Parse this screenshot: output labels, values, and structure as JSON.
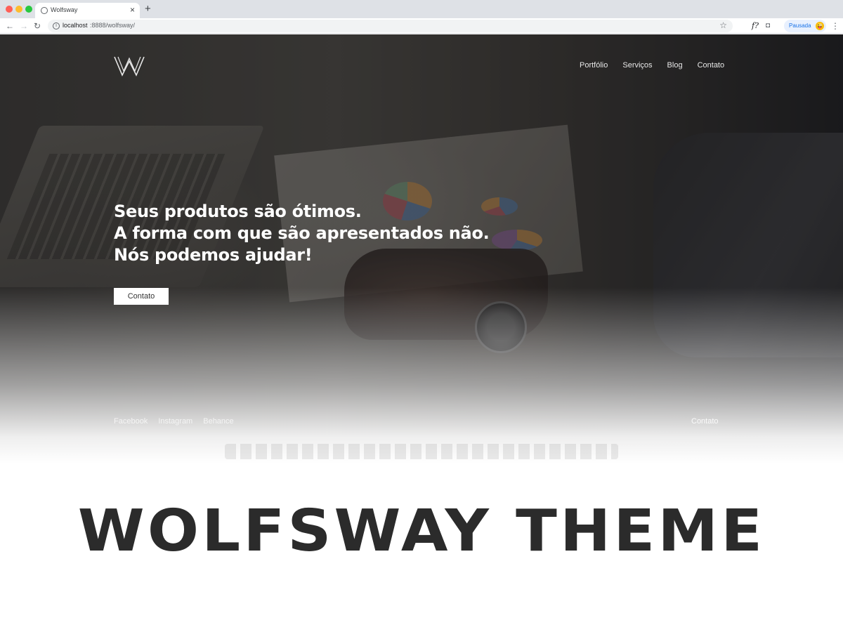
{
  "browser": {
    "tab_title": "Wolfsway",
    "tab_close": "×",
    "new_tab": "+",
    "url_host": "localhost",
    "url_path": ":8888/wolfsway/",
    "back": "←",
    "forward": "→",
    "reload": "↻",
    "info": "i",
    "star": "☆",
    "ext_f": "f?",
    "camera": "◘",
    "profile_label": "Pausada",
    "avatar": "😜",
    "menu": "⋮"
  },
  "site": {
    "nav": [
      "Portfólio",
      "Serviços",
      "Blog",
      "Contato"
    ],
    "headline": [
      "Seus produtos são ótimos.",
      "A forma com que são apresentados não.",
      "Nós podemos ajudar!"
    ],
    "cta_label": "Contato",
    "social": [
      "Facebook",
      "Instagram",
      "Behance"
    ],
    "footer_contact": "Contato"
  },
  "theme_title": "WOLFSWAY THEME",
  "colors": {
    "hero_overlay": "#141416",
    "text_light": "#ffffff",
    "title_dark": "#2b2b2b"
  }
}
